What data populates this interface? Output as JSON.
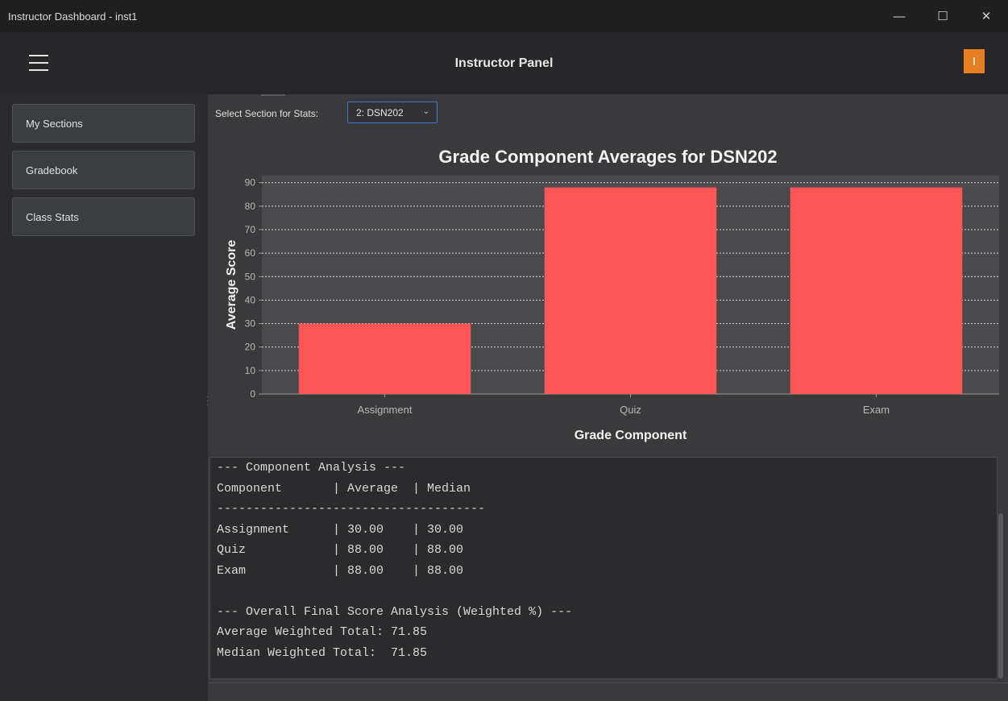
{
  "window": {
    "title": "Instructor Dashboard - inst1",
    "minimize": "—",
    "maximize": "☐",
    "close": "✕"
  },
  "header": {
    "title": "Instructor Panel",
    "avatar_letter": "I",
    "avatar_color": "#e67e22"
  },
  "sidebar": {
    "items": [
      {
        "label": "My Sections"
      },
      {
        "label": "Gradebook"
      },
      {
        "label": "Class Stats"
      }
    ]
  },
  "section_select": {
    "label": "Select Section for Stats:",
    "value": "2: DSN202"
  },
  "chart_data": {
    "type": "bar",
    "title": "Grade Component Averages for DSN202",
    "xlabel": "Grade Component",
    "ylabel": "Average Score",
    "categories": [
      "Assignment",
      "Quiz",
      "Exam"
    ],
    "values": [
      30,
      88,
      88
    ],
    "ylim": [
      0,
      93
    ],
    "yticks": [
      0,
      10,
      20,
      30,
      40,
      50,
      60,
      70,
      80,
      90
    ],
    "bar_color": "#ff5555",
    "grid": true
  },
  "analysis": {
    "lines": [
      "--- Component Analysis ---",
      "Component       | Average  | Median",
      "-------------------------------------",
      "Assignment      | 30.00    | 30.00",
      "Quiz            | 88.00    | 88.00",
      "Exam            | 88.00    | 88.00",
      "",
      "--- Overall Final Score Analysis (Weighted %) ---",
      "Average Weighted Total: 71.85",
      "Median Weighted Total:  71.85"
    ]
  }
}
